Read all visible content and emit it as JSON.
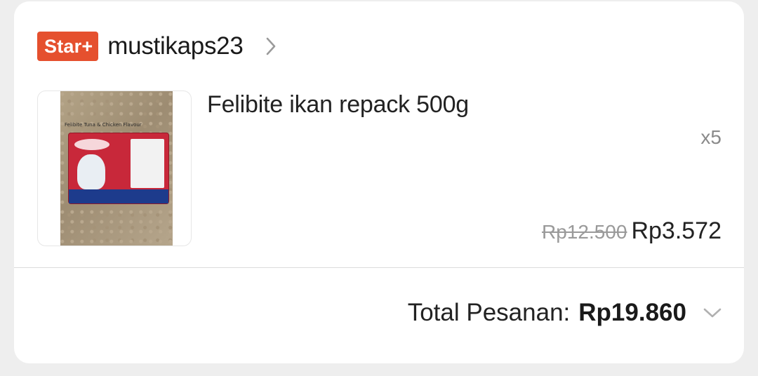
{
  "shop": {
    "badge": "Star+",
    "name": "mustikaps23",
    "icon": "chevron-right-icon"
  },
  "product": {
    "name": "Felibite ikan repack 500g",
    "quantity": "x5",
    "original_price": "Rp12.500",
    "price": "Rp3.572",
    "image_caption": "Felibite Tuna & Chicken Flavour"
  },
  "order_total": {
    "label": "Total Pesanan:",
    "value": "Rp19.860",
    "icon": "chevron-down-icon"
  },
  "colors": {
    "badge": "#e5502e",
    "background": "#eeeeee",
    "card": "#ffffff"
  }
}
